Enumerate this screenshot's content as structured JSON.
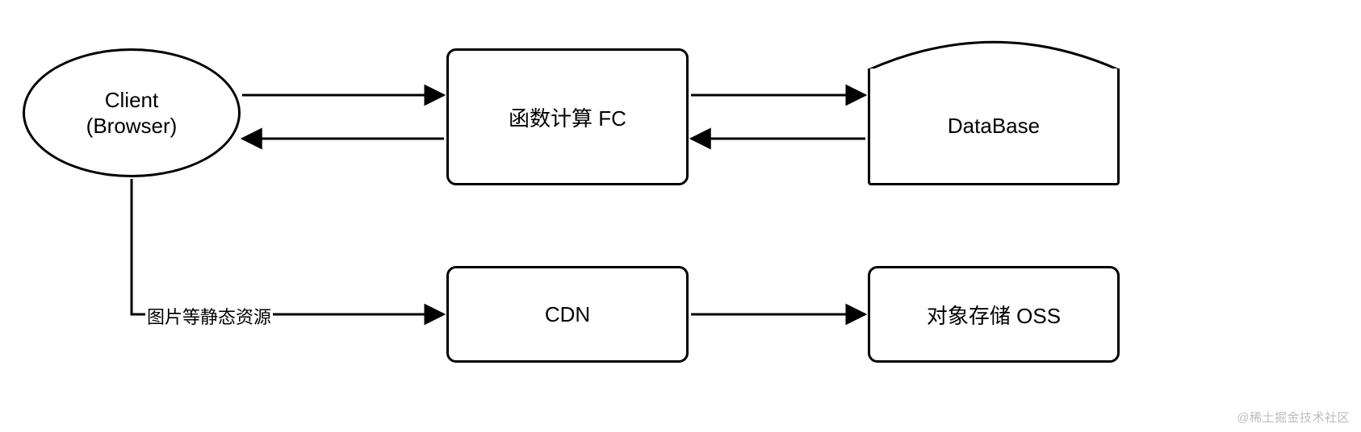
{
  "nodes": {
    "client": {
      "line1": "Client",
      "line2": "(Browser)"
    },
    "fc": {
      "label": "函数计算 FC"
    },
    "db": {
      "label": "DataBase"
    },
    "cdn": {
      "label": "CDN"
    },
    "oss": {
      "label": "对象存储 OSS"
    }
  },
  "edges": {
    "client_to_cdn_label": "图片等静态资源"
  },
  "watermark": "@稀土掘金技术社区",
  "chart_data": {
    "type": "diagram",
    "title": "",
    "nodes": [
      {
        "id": "client",
        "label": "Client (Browser)",
        "shape": "ellipse"
      },
      {
        "id": "fc",
        "label": "函数计算 FC",
        "shape": "rounded-rect"
      },
      {
        "id": "db",
        "label": "DataBase",
        "shape": "database"
      },
      {
        "id": "cdn",
        "label": "CDN",
        "shape": "rounded-rect"
      },
      {
        "id": "oss",
        "label": "对象存储 OSS",
        "shape": "rounded-rect"
      }
    ],
    "edges": [
      {
        "from": "client",
        "to": "fc",
        "direction": "both",
        "label": ""
      },
      {
        "from": "fc",
        "to": "db",
        "direction": "both",
        "label": ""
      },
      {
        "from": "client",
        "to": "cdn",
        "direction": "forward",
        "label": "图片等静态资源"
      },
      {
        "from": "cdn",
        "to": "oss",
        "direction": "forward",
        "label": ""
      }
    ]
  }
}
